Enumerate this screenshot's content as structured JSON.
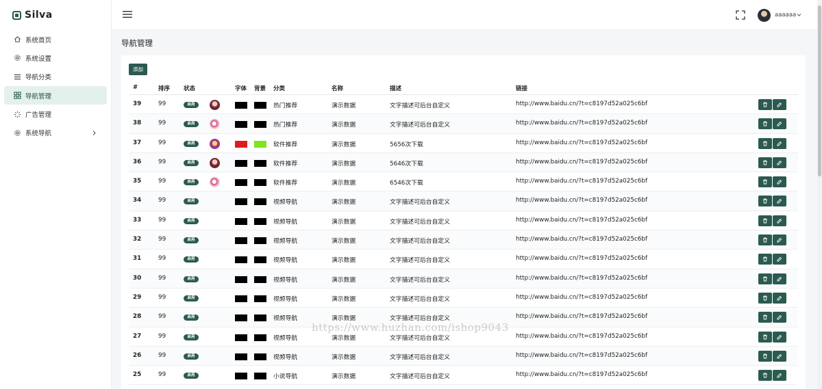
{
  "brand": {
    "name": "Silva"
  },
  "sidebar": {
    "items": [
      {
        "label": "系统首页",
        "icon": "home-icon",
        "active": false
      },
      {
        "label": "系统设置",
        "icon": "gear-icon",
        "active": false
      },
      {
        "label": "导航分类",
        "icon": "list-icon",
        "active": false
      },
      {
        "label": "导航管理",
        "icon": "grid-icon",
        "active": true
      },
      {
        "label": "广告管理",
        "icon": "loader-icon",
        "active": false
      },
      {
        "label": "系统导航",
        "icon": "gear-icon",
        "active": false,
        "has_children": true
      }
    ]
  },
  "header": {
    "user_name": "aaaaaa"
  },
  "page": {
    "title": "导航管理"
  },
  "toolbar": {
    "add_label": "添加"
  },
  "table": {
    "headers": [
      "#",
      "排序",
      "状态",
      "字体",
      "背景",
      "分类",
      "名称",
      "描述",
      "链接"
    ],
    "rows": [
      {
        "id": "39",
        "sort": "99",
        "status": "启用",
        "icon": "avatar-a",
        "font_color": "#000000",
        "bg_color": "#000000",
        "category": "热门推荐",
        "name": "演示数据",
        "desc": "文字描述可后台自定义",
        "link": "http://www.baidu.cn/?t=c8197d52a025c6bf"
      },
      {
        "id": "38",
        "sort": "99",
        "status": "启用",
        "icon": "avatar-b",
        "font_color": "#000000",
        "bg_color": "#000000",
        "category": "热门推荐",
        "name": "演示数据",
        "desc": "文字描述可后台自定义",
        "link": "http://www.baidu.cn/?t=c8197d52a025c6bf"
      },
      {
        "id": "37",
        "sort": "99",
        "status": "启用",
        "icon": "avatar-c",
        "font_color": "#e01a1a",
        "bg_color": "#7ee51f",
        "category": "软件推荐",
        "name": "演示数据",
        "desc": "5656次下载",
        "link": "http://www.baidu.cn/?t=c8197d52a025c6bf"
      },
      {
        "id": "36",
        "sort": "99",
        "status": "启用",
        "icon": "avatar-a",
        "font_color": "#000000",
        "bg_color": "#000000",
        "category": "软件推荐",
        "name": "演示数据",
        "desc": "5646次下载",
        "link": "http://www.baidu.cn/?t=c8197d52a025c6bf"
      },
      {
        "id": "35",
        "sort": "99",
        "status": "启用",
        "icon": "avatar-b",
        "font_color": "#000000",
        "bg_color": "#000000",
        "category": "软件推荐",
        "name": "演示数据",
        "desc": "6546次下载",
        "link": "http://www.baidu.cn/?t=c8197d52a025c6bf"
      },
      {
        "id": "34",
        "sort": "99",
        "status": "启用",
        "icon": "",
        "font_color": "#000000",
        "bg_color": "#000000",
        "category": "视频导航",
        "name": "演示数据",
        "desc": "文字描述可后台自定义",
        "link": "http://www.baidu.cn/?t=c8197d52a025c6bf"
      },
      {
        "id": "33",
        "sort": "99",
        "status": "启用",
        "icon": "",
        "font_color": "#000000",
        "bg_color": "#000000",
        "category": "视频导航",
        "name": "演示数据",
        "desc": "文字描述可后台自定义",
        "link": "http://www.baidu.cn/?t=c8197d52a025c6bf"
      },
      {
        "id": "32",
        "sort": "99",
        "status": "启用",
        "icon": "",
        "font_color": "#000000",
        "bg_color": "#000000",
        "category": "视频导航",
        "name": "演示数据",
        "desc": "文字描述可后台自定义",
        "link": "http://www.baidu.cn/?t=c8197d52a025c6bf"
      },
      {
        "id": "31",
        "sort": "99",
        "status": "启用",
        "icon": "",
        "font_color": "#000000",
        "bg_color": "#000000",
        "category": "视频导航",
        "name": "演示数据",
        "desc": "文字描述可后台自定义",
        "link": "http://www.baidu.cn/?t=c8197d52a025c6bf"
      },
      {
        "id": "30",
        "sort": "99",
        "status": "启用",
        "icon": "",
        "font_color": "#000000",
        "bg_color": "#000000",
        "category": "视频导航",
        "name": "演示数据",
        "desc": "文字描述可后台自定义",
        "link": "http://www.baidu.cn/?t=c8197d52a025c6bf"
      },
      {
        "id": "29",
        "sort": "99",
        "status": "启用",
        "icon": "",
        "font_color": "#000000",
        "bg_color": "#000000",
        "category": "视频导航",
        "name": "演示数据",
        "desc": "文字描述可后台自定义",
        "link": "http://www.baidu.cn/?t=c8197d52a025c6bf"
      },
      {
        "id": "28",
        "sort": "99",
        "status": "启用",
        "icon": "",
        "font_color": "#000000",
        "bg_color": "#000000",
        "category": "视频导航",
        "name": "演示数据",
        "desc": "文字描述可后台自定义",
        "link": "http://www.baidu.cn/?t=c8197d52a025c6bf"
      },
      {
        "id": "27",
        "sort": "99",
        "status": "启用",
        "icon": "",
        "font_color": "#000000",
        "bg_color": "#000000",
        "category": "视频导航",
        "name": "演示数据",
        "desc": "文字描述可后台自定义",
        "link": "http://www.baidu.cn/?t=c8197d52a025c6bf"
      },
      {
        "id": "26",
        "sort": "99",
        "status": "启用",
        "icon": "",
        "font_color": "#000000",
        "bg_color": "#000000",
        "category": "视频导航",
        "name": "演示数据",
        "desc": "文字描述可后台自定义",
        "link": "http://www.baidu.cn/?t=c8197d52a025c6bf"
      },
      {
        "id": "25",
        "sort": "99",
        "status": "启用",
        "icon": "",
        "font_color": "#000000",
        "bg_color": "#000000",
        "category": "小说导航",
        "name": "演示数据",
        "desc": "文字描述可后台自定义",
        "link": "http://www.baidu.cn/?t=c8197d52a025c6bf"
      }
    ]
  },
  "watermark": {
    "text": "https://www.huzhan.com/ishop9043"
  },
  "colors": {
    "accent": "#2b5a50",
    "active_bg": "#e4f0ec"
  }
}
